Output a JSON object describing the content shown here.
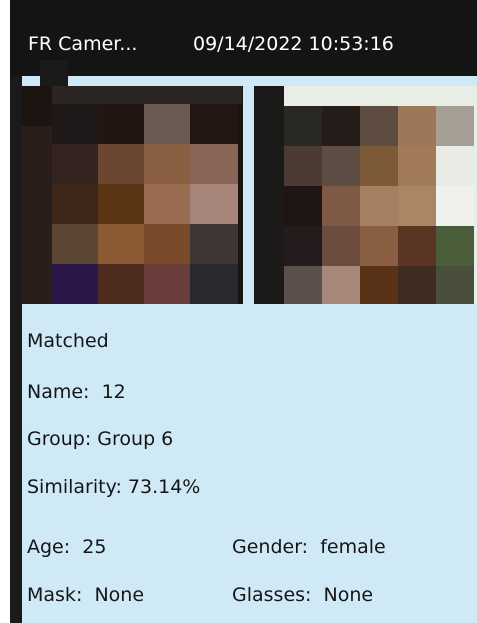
{
  "header": {
    "camera_name": "FR Camer...",
    "timestamp": "09/14/2022 10:53:16"
  },
  "images": {
    "snapshot_icon": "face-snapshot",
    "library_icon": "face-library-photo"
  },
  "match": {
    "status": "Matched",
    "name_label": "Name:",
    "name_value": "12",
    "group_label": "Group:",
    "group_value": "Group 6",
    "similarity_label": "Similarity:",
    "similarity_value": "73.14%",
    "age_label": "Age:",
    "age_value": "25",
    "gender_label": "Gender:",
    "gender_value": "female",
    "mask_label": "Mask:",
    "mask_value": "None",
    "glasses_label": "Glasses:",
    "glasses_value": "None"
  },
  "colors": {
    "card_bg": "#cfe9f7",
    "header_bg": "#141414"
  }
}
